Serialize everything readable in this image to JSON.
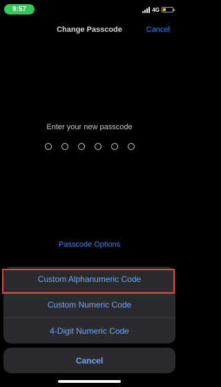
{
  "status_bar": {
    "time": "9:57",
    "network": "4G",
    "battery_color": "#ffd60a",
    "battery_level": 0.3,
    "signal_bars": 4
  },
  "nav": {
    "title": "Change Passcode",
    "cancel_label": "Cancel"
  },
  "prompt": "Enter your new passcode",
  "passcode_length": 6,
  "options_link": "Passcode Options",
  "action_sheet": {
    "items": [
      {
        "label": "Custom Alphanumeric Code",
        "highlighted": true
      },
      {
        "label": "Custom Numeric Code"
      },
      {
        "label": "4-Digit Numeric Code"
      }
    ],
    "cancel_label": "Cancel"
  },
  "colors": {
    "accent": "#3b82f6",
    "sheet_text": "#6ea6ff",
    "highlight_border": "#e2453c",
    "time_pill": "#34c759"
  }
}
